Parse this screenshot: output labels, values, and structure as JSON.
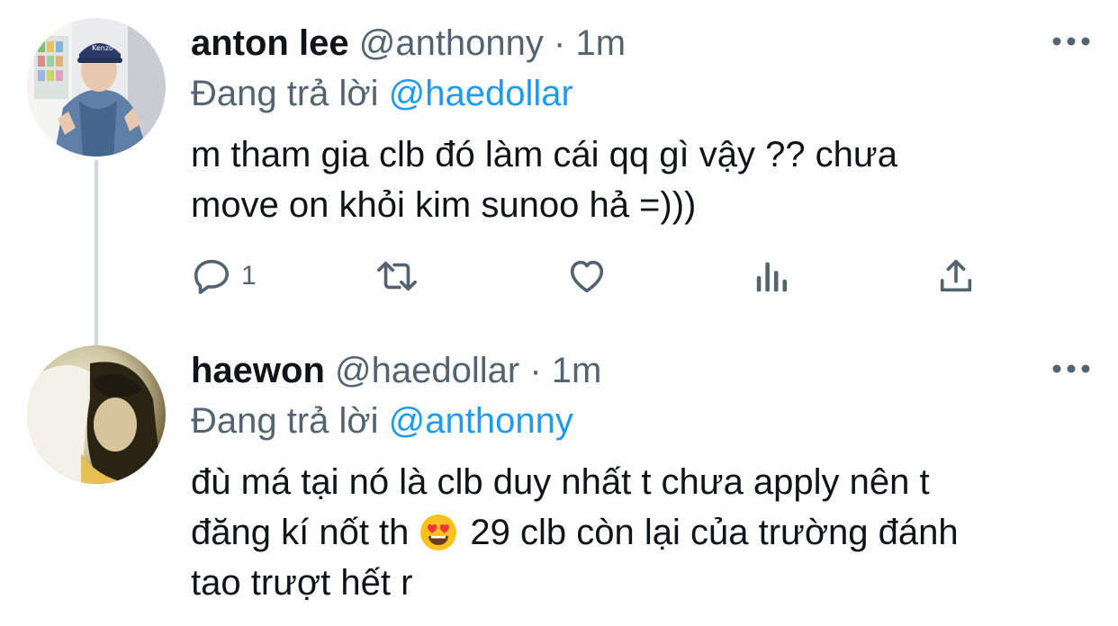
{
  "tweets": [
    {
      "display_name": "anton lee",
      "handle": "@anthonny",
      "separator": "·",
      "time": "1m",
      "reply_prefix": "Đang trả lời",
      "reply_to": "@haedollar",
      "text_line1": "m tham gia clb đó làm cái qq gì vậy ?? chưa",
      "text_line2": "move on khỏi kim sunoo hả =)))",
      "reply_count": "1"
    },
    {
      "display_name": "haewon",
      "handle": "@haedollar",
      "separator": "·",
      "time": "1m",
      "reply_prefix": "Đang trả lời",
      "reply_to": "@anthonny",
      "text_line1": "đù má tại nó là clb duy nhất t chưa apply nên t",
      "text_line2a": "đăng kí nốt th",
      "text_line2b": "29 clb còn lại của trường đánh",
      "text_line3": "tao trượt hết r"
    }
  ],
  "colors": {
    "mention": "#1d9bf0",
    "secondary_text": "#536471",
    "thread_line": "#cfd9de"
  },
  "icons": [
    "reply-icon",
    "retweet-icon",
    "like-icon",
    "views-icon",
    "share-icon",
    "more-icon",
    "heart-eyes-emoji"
  ]
}
